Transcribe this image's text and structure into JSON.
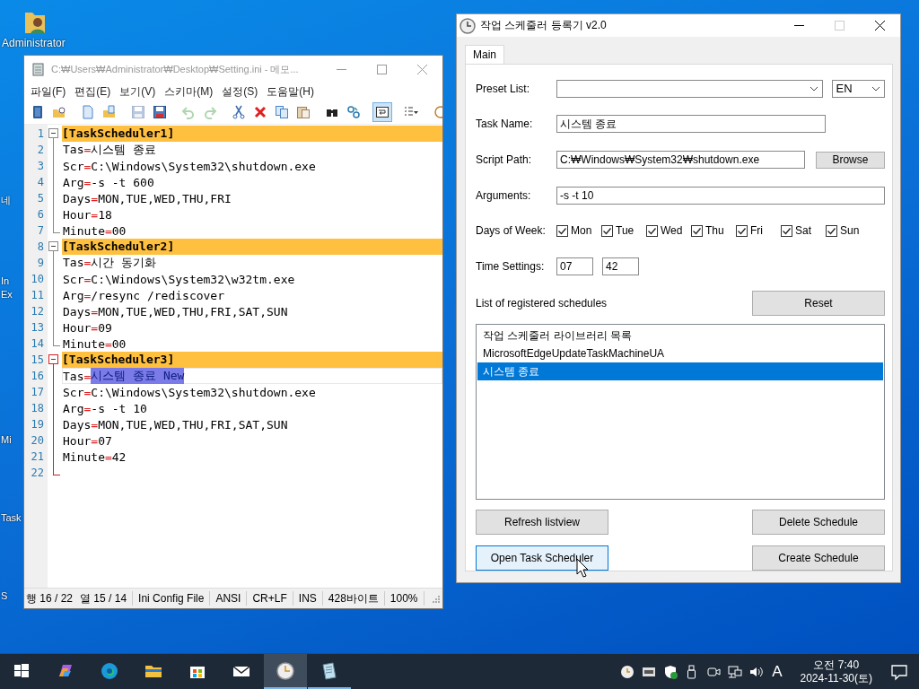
{
  "desktop_icons": [
    {
      "label": "Administrator",
      "kind": "user-folder"
    },
    {
      "label": "네",
      "kind": "partial"
    },
    {
      "label": "In",
      "kind": "partial"
    },
    {
      "label": "Ex",
      "kind": "partial"
    },
    {
      "label": "Mi",
      "kind": "partial"
    },
    {
      "label": "Task",
      "kind": "partial"
    },
    {
      "label": "S",
      "kind": "partial"
    }
  ],
  "notepad": {
    "title": "C:₩Users₩Administrator₩Desktop₩Setting.ini - 메모...",
    "menu": [
      "파일(F)",
      "편집(E)",
      "보기(V)",
      "스키마(M)",
      "설정(S)",
      "도움말(H)"
    ],
    "toolbar": [
      [
        {
          "kind": "book",
          "disabled": false,
          "on": false
        },
        {
          "kind": "folder-search",
          "disabled": false,
          "on": false
        }
      ],
      [
        {
          "kind": "new",
          "disabled": false,
          "on": false
        },
        {
          "kind": "open",
          "disabled": false,
          "on": false
        }
      ],
      [
        {
          "kind": "save",
          "disabled": true,
          "on": false
        },
        {
          "kind": "save-as",
          "disabled": false,
          "on": false
        }
      ],
      [
        {
          "kind": "undo",
          "disabled": true,
          "on": false
        },
        {
          "kind": "redo",
          "disabled": true,
          "on": false
        }
      ],
      [
        {
          "kind": "cut",
          "disabled": false,
          "on": false
        },
        {
          "kind": "delete",
          "disabled": false,
          "on": false
        },
        {
          "kind": "copy",
          "disabled": false,
          "on": false
        },
        {
          "kind": "paste",
          "disabled": false,
          "on": false
        }
      ],
      [
        {
          "kind": "find",
          "disabled": false,
          "on": false
        },
        {
          "kind": "replace",
          "disabled": false,
          "on": false
        }
      ],
      [
        {
          "kind": "wrap",
          "disabled": false,
          "on": true
        }
      ],
      [
        {
          "kind": "list",
          "disabled": false,
          "on": false
        }
      ],
      [
        {
          "kind": "zoom",
          "disabled": false,
          "on": false
        }
      ]
    ],
    "sections": [
      {
        "active": false,
        "header": {
          "n": "1",
          "text": "[TaskScheduler1]"
        },
        "lines": [
          {
            "n": "2",
            "text": "Tas=시스템 종료",
            "current": false
          },
          {
            "n": "3",
            "text": "Scr=C:\\Windows\\System32\\shutdown.exe",
            "current": false
          },
          {
            "n": "4",
            "text": "Arg=-s -t 600",
            "current": false
          },
          {
            "n": "5",
            "text": "Days=MON,TUE,WED,THU,FRI",
            "current": false
          },
          {
            "n": "6",
            "text": "Hour=18",
            "current": false
          },
          {
            "n": "7",
            "text": "Minute=00",
            "current": false
          }
        ]
      },
      {
        "active": false,
        "header": {
          "n": "8",
          "text": "[TaskScheduler2]"
        },
        "lines": [
          {
            "n": "9",
            "text": "Tas=시간 동기화",
            "current": false
          },
          {
            "n": "10",
            "text": "Scr=C:\\Windows\\System32\\w32tm.exe",
            "current": false
          },
          {
            "n": "11",
            "text": "Arg=/resync /rediscover",
            "current": false
          },
          {
            "n": "12",
            "text": "Days=MON,TUE,WED,THU,FRI,SAT,SUN",
            "current": false
          },
          {
            "n": "13",
            "text": "Hour=09",
            "current": false
          },
          {
            "n": "14",
            "text": "Minute=00",
            "current": false
          }
        ]
      },
      {
        "active": true,
        "header": {
          "n": "15",
          "text": "[TaskScheduler3]"
        },
        "lines": [
          {
            "n": "16",
            "text": "Tas=",
            "selection": "시스템 종료 New",
            "current": true
          },
          {
            "n": "17",
            "text": "Scr=C:\\Windows\\System32\\shutdown.exe",
            "current": false
          },
          {
            "n": "18",
            "text": "Arg=-s -t 10",
            "current": false
          },
          {
            "n": "19",
            "text": "Days=MON,TUE,WED,THU,FRI,SAT,SUN",
            "current": false
          },
          {
            "n": "20",
            "text": "Hour=07",
            "current": false
          },
          {
            "n": "21",
            "text": "Minute=42",
            "current": false
          },
          {
            "n": "22",
            "current": false
          }
        ]
      }
    ],
    "status_bar": [
      [
        "행 16 / 22",
        "열 15 / 14"
      ],
      [
        "Ini Config File"
      ],
      [
        "ANSI"
      ],
      [
        "CR+LF"
      ],
      [
        "INS"
      ],
      [
        "428바이트"
      ],
      [
        "100%"
      ]
    ]
  },
  "scheduler": {
    "title": "작업 스케줄러 등록기 v2.0",
    "tabs": [
      {
        "label": "Main",
        "selected": true
      }
    ],
    "preset_label": "Preset List:",
    "language": "EN",
    "task_name_label": "Task Name:",
    "task_name": "시스템 종료",
    "script_path_label": "Script Path:",
    "script_path": "C:₩Windows₩System32₩shutdown.exe",
    "browse_button": "Browse",
    "arguments_label": "Arguments:",
    "arguments": "-s -t 10",
    "days_label": "Days of Week:",
    "days": [
      {
        "label": "Mon",
        "checked": true
      },
      {
        "label": "Tue",
        "checked": true
      },
      {
        "label": "Wed",
        "checked": true
      },
      {
        "label": "Thu",
        "checked": true
      },
      {
        "label": "Fri",
        "checked": true
      },
      {
        "label": "Sat",
        "checked": true
      },
      {
        "label": "Sun",
        "checked": true
      }
    ],
    "time_label": "Time Settings:",
    "hour": "07",
    "minute": "42",
    "list_label": "List of registered schedules",
    "reset_button": "Reset",
    "schedules": [
      {
        "label": "작업 스케줄러 라이브러리 목록",
        "selected": false
      },
      {
        "label": "MicrosoftEdgeUpdateTaskMachineUA",
        "selected": false
      },
      {
        "label": "시스템 종료",
        "selected": true
      }
    ],
    "buttons": [
      "Refresh listview",
      "Delete Schedule",
      "Open Task Scheduler",
      "Create Schedule"
    ]
  },
  "taskbar": {
    "apps": [
      {
        "kind": "start",
        "running": false,
        "selected": false
      },
      {
        "kind": "copilot",
        "running": false,
        "selected": false
      },
      {
        "kind": "edge",
        "running": false,
        "selected": false
      },
      {
        "kind": "explorer",
        "running": false,
        "selected": false
      },
      {
        "kind": "store",
        "running": false,
        "selected": false
      },
      {
        "kind": "mail",
        "running": false,
        "selected": false
      },
      {
        "kind": "clock",
        "running": true,
        "selected": true
      },
      {
        "kind": "notepad",
        "running": true,
        "selected": false
      }
    ],
    "tray": [
      {
        "kind": "clock"
      },
      {
        "kind": "vm"
      },
      {
        "kind": "shield"
      },
      {
        "kind": "usb"
      },
      {
        "kind": "camera"
      },
      {
        "kind": "network"
      },
      {
        "kind": "volume"
      }
    ],
    "input_indicator": "A",
    "time": "오전 7:40",
    "date": "2024-11-30(토)"
  }
}
